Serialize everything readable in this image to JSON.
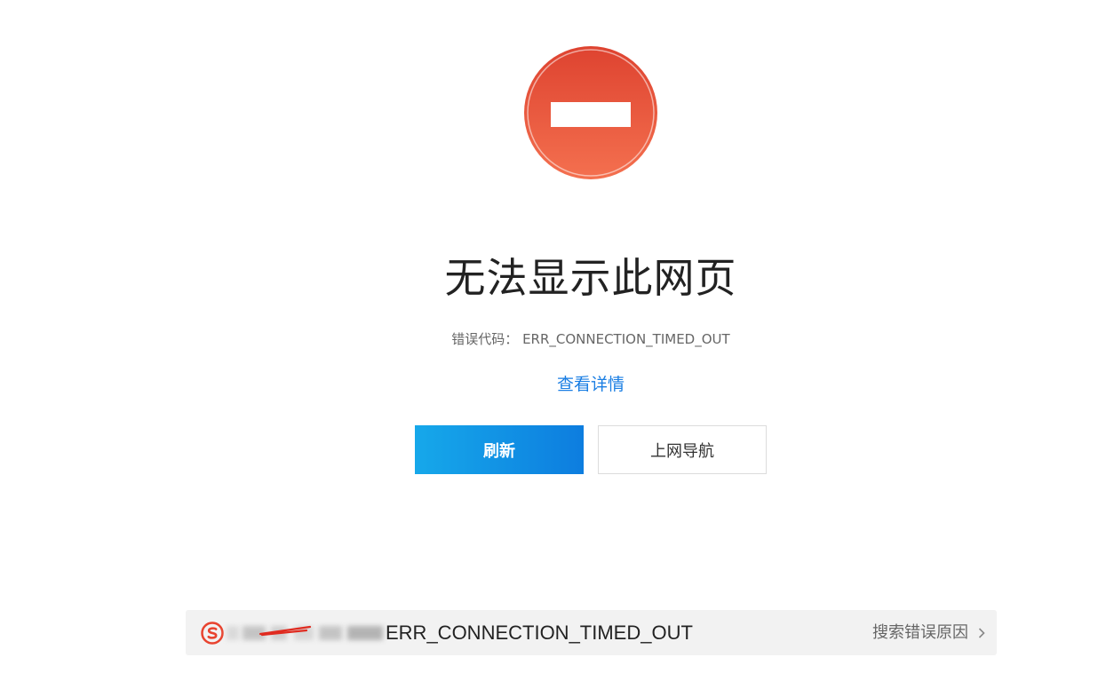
{
  "error_page": {
    "title": "无法显示此网页",
    "error_code_line": "错误代码： ERR_CONNECTION_TIMED_OUT",
    "details_link": "查看详情",
    "refresh_button": "刷新",
    "nav_button": "上网导航"
  },
  "search_bar": {
    "query_text": "ERR_CONNECTION_TIMED_OUT",
    "search_reason_label": "搜索错误原因",
    "engine_icon": "sogou-logo-icon"
  },
  "colors": {
    "stop_icon": "#e95a40",
    "link": "#1a7ee3",
    "refresh_button_start": "#16a8ea",
    "refresh_button_end": "#0d7ddf",
    "search_bar_bg": "#f2f2f2"
  }
}
